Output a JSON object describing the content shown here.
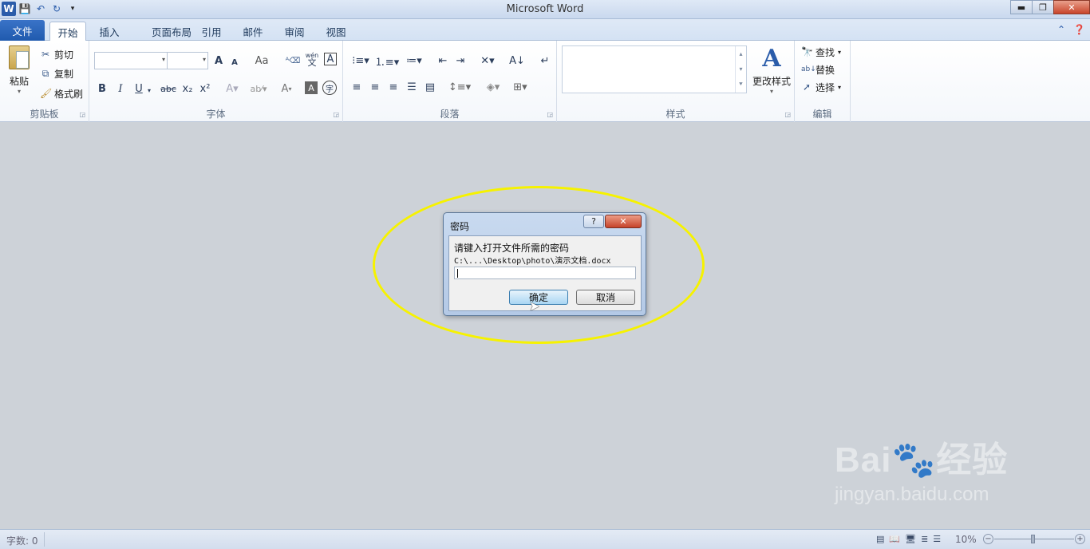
{
  "window": {
    "title": "Microsoft Word",
    "qat_icons": [
      "word-logo-icon",
      "save-icon",
      "undo-icon",
      "redo-icon",
      "customize-qat-icon"
    ],
    "minimize_glyph": "▬",
    "restore_glyph": "❐",
    "close_glyph": "✕"
  },
  "tabs": {
    "file": "文件",
    "items": [
      "开始",
      "插入",
      "页面布局",
      "引用",
      "邮件",
      "审阅",
      "视图"
    ],
    "active": "开始"
  },
  "ribbon": {
    "clipboard": {
      "label": "剪贴板",
      "paste": "粘贴",
      "cut": "剪切",
      "copy": "复制",
      "format_painter": "格式刷"
    },
    "font": {
      "label": "字体",
      "font_name": "",
      "font_size": "",
      "grow": "A",
      "shrink": "A",
      "change_case": "Aa",
      "bold": "B",
      "italic": "I",
      "underline": "U",
      "strike": "abc",
      "subscript": "x₂",
      "superscript": "x²",
      "font_color": "A",
      "phonetic": "wén",
      "phonetic_bottom": "文",
      "char_border": "A",
      "enclose_char": "字"
    },
    "paragraph": {
      "label": "段落"
    },
    "styles": {
      "label": "样式",
      "change_styles": "更改样式"
    },
    "editing": {
      "label": "编辑",
      "find": "查找",
      "replace": "替换",
      "select": "选择"
    }
  },
  "dialog": {
    "title": "密码",
    "help": "?",
    "close": "✕",
    "prompt": "请键入打开文件所需的密码",
    "path": "C:\\...\\Desktop\\photo\\演示文档.docx",
    "password_value": "",
    "ok": "确定",
    "cancel": "取消"
  },
  "watermark": {
    "brand": "Bai🐾经验",
    "url": "jingyan.baidu.com"
  },
  "status": {
    "word_count": "字数: 0",
    "zoom": "10%"
  },
  "colors": {
    "highlight_ellipse": "#f6f200",
    "file_tab": "#2a5caa",
    "doc_background": "#cdd2d8"
  }
}
